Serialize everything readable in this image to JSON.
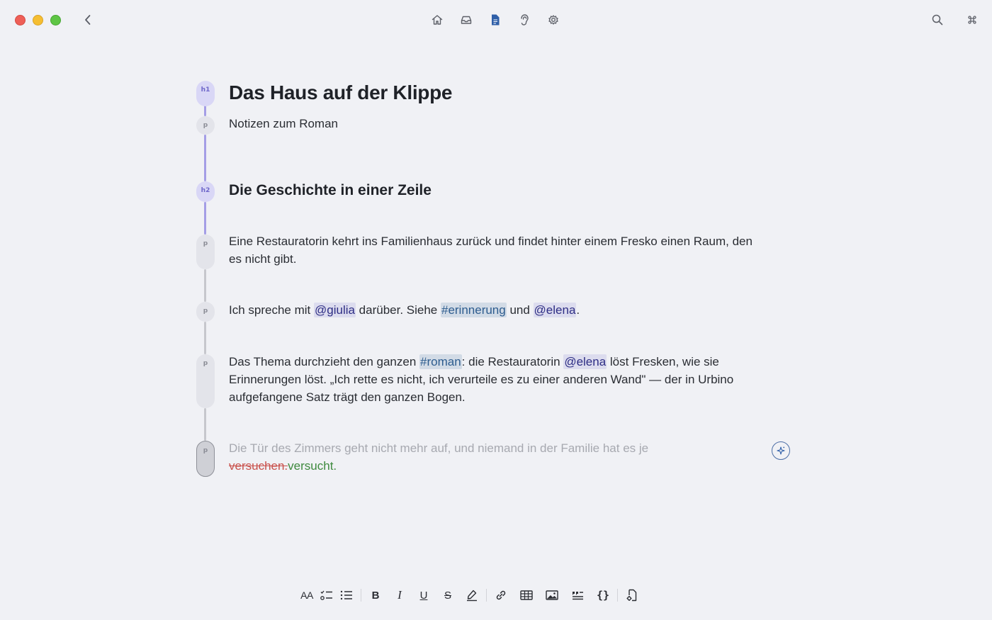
{
  "document": {
    "title": "Das Haus auf der Klippe",
    "subtitle": "Notizen zum Roman",
    "heading2": "Die Geschichte in einer Zeile",
    "para1": "Eine Restauratorin kehrt ins Familienhaus zurück und findet hinter einem Fresko einen Raum, den es nicht gibt.",
    "para2": {
      "t1": "Ich spreche mit ",
      "mention1": "@giulia",
      "t2": " darüber. Siehe ",
      "tag1": "#erinnerung",
      "t3": " und ",
      "mention2": "@elena",
      "t4": "."
    },
    "para3": {
      "t1": "Das Thema durchzieht den ganzen ",
      "tag1": "#roman",
      "t2": ": die Restauratorin ",
      "mention1": "@elena",
      "t3": " löst Fresken, wie sie Erinnerungen löst. „Ich rette es nicht, ich verurteile es zu einer anderen Wand\" — der in Urbino aufgefangene Satz trägt den ganzen Bogen."
    },
    "para4": {
      "ghost": "Die Tür des Zimmers geht nicht mehr auf, und niemand in der Familie hat es je ",
      "deleted": "versuchen.",
      "inserted": "versucht."
    }
  },
  "gutter": {
    "h1": "h1",
    "h2": "h2",
    "p": "p"
  },
  "toolbar": {
    "text_size": "AA",
    "bold": "B",
    "italic": "I",
    "underline": "U",
    "strike": "S",
    "code": "{}"
  },
  "colors": {
    "accent": "#2f5fa8",
    "mention_bg": "#dcdcee",
    "tag_bg": "#d2dbe6",
    "deleted": "#c9524d",
    "inserted": "#3e8a3e",
    "heading_marker": "#d9d7f6"
  }
}
